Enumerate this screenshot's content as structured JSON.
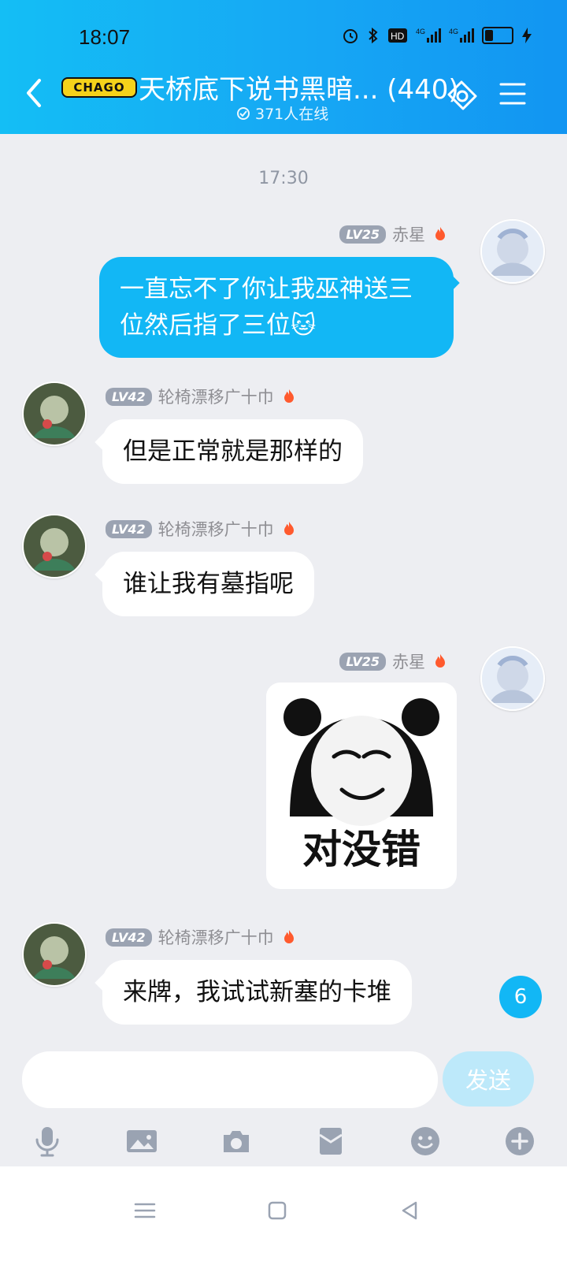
{
  "status": {
    "time": "18:07",
    "indicators": [
      "alarm-icon",
      "bluetooth-icon",
      "hd-icon",
      "4g-signal-icon",
      "4g-signal-icon",
      "battery-icon"
    ]
  },
  "header": {
    "logo_text": "CHAGO",
    "title": "天桥底下说书黑暗... (440)",
    "online_text": "371人在线",
    "accent": "#12B7F5"
  },
  "chat": {
    "timestamp": "17:30",
    "messages": [
      {
        "side": "right",
        "level": "LV25",
        "name": "赤星",
        "type": "text",
        "text": "一直忘不了你让我巫神送三位然后指了三位🐱"
      },
      {
        "side": "left",
        "level": "LV42",
        "name": "轮椅漂移广十巾",
        "type": "text",
        "text": "但是正常就是那样的"
      },
      {
        "side": "left",
        "level": "LV42",
        "name": "轮椅漂移广十巾",
        "type": "text",
        "text": "谁让我有墓指呢"
      },
      {
        "side": "right",
        "level": "LV25",
        "name": "赤星",
        "type": "sticker",
        "sticker_text": "对没错"
      },
      {
        "side": "left",
        "level": "LV42",
        "name": "轮椅漂移广十巾",
        "type": "text",
        "text": "来牌，我试试新塞的卡堆"
      }
    ],
    "unread_count": "6"
  },
  "composer": {
    "input_placeholder": "",
    "send_label": "发送",
    "tools": [
      "microphone-icon",
      "image-icon",
      "camera-icon",
      "red-packet-icon",
      "emoji-icon",
      "plus-icon"
    ]
  },
  "system_nav": [
    "recent-apps-icon",
    "home-icon",
    "back-icon"
  ]
}
